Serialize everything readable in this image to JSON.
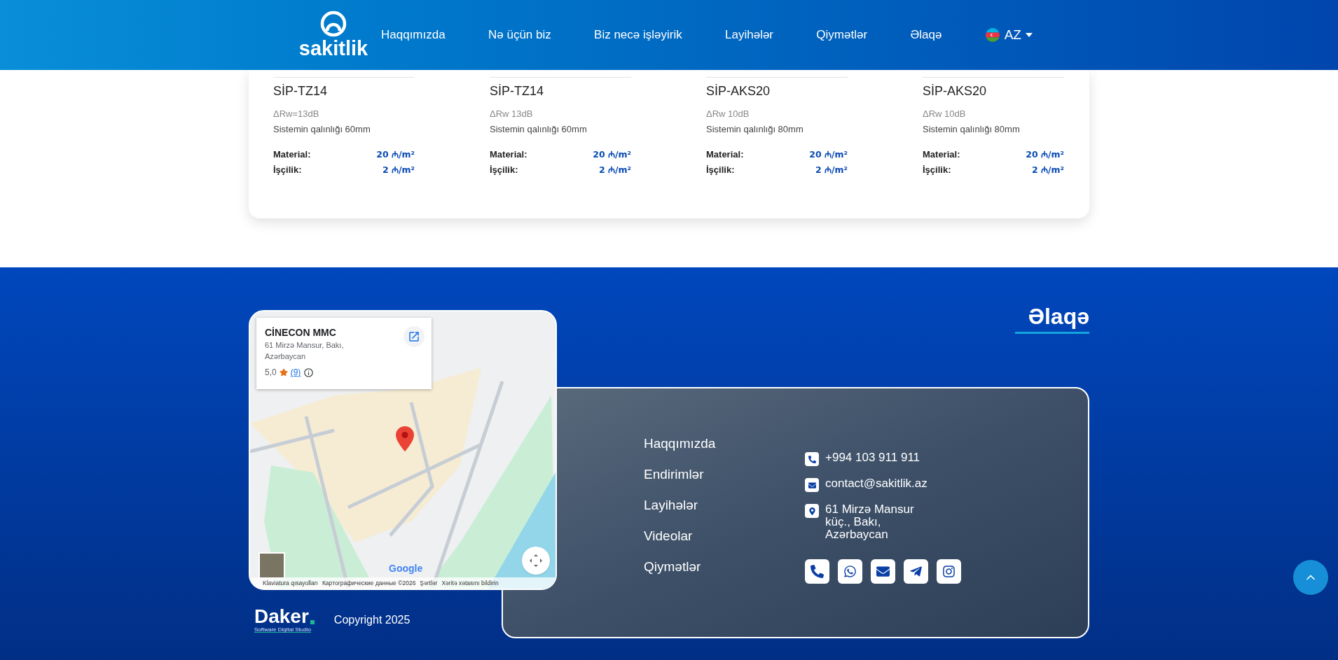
{
  "header": {
    "logo": "sakitlik",
    "nav": [
      "Haqqımızda",
      "Nə üçün biz",
      "Biz necə işləyirik",
      "Layihələr",
      "Qiymətlər",
      "Əlaqə"
    ],
    "language": {
      "code": "AZ"
    }
  },
  "products": [
    {
      "name": "SİP-TZ14",
      "specs": [
        "ΔRw=13dB",
        "Sistemin qalınlığı 60mm"
      ],
      "prices": [
        {
          "label": "Material:",
          "value": "20 ₼/m²"
        },
        {
          "label": "İşçilik:",
          "value": "2 ₼/m²"
        }
      ]
    },
    {
      "name": "SİP-TZ14",
      "specs": [
        "ΔRw 13dB",
        "Sistemin qalınlığı 60mm"
      ],
      "prices": [
        {
          "label": "Material:",
          "value": "20 ₼/m²"
        },
        {
          "label": "İşçilik:",
          "value": "2 ₼/m²"
        }
      ]
    },
    {
      "name": "SİP-AKS20",
      "specs": [
        "ΔRw 10dB",
        "Sistemin qalınlığı 80mm"
      ],
      "prices": [
        {
          "label": "Material:",
          "value": "20 ₼/m²"
        },
        {
          "label": "İşçilik:",
          "value": "2 ₼/m²"
        }
      ]
    },
    {
      "name": "SİP-AKS20",
      "specs": [
        "ΔRw 10dB",
        "Sistemin qalınlığı 80mm"
      ],
      "prices": [
        {
          "label": "Material:",
          "value": "20 ₼/m²"
        },
        {
          "label": "İşçilik:",
          "value": "2 ₼/m²"
        }
      ]
    }
  ],
  "map": {
    "place": "CİNECON MMC",
    "address": "61 Mirzə Mansur, Bakı, Azərbaycan",
    "rating": "5,0",
    "reviews": "(9)",
    "logo": "Google",
    "attribution": [
      "Klaviatura qısayolları",
      "Картографические данные ©2026",
      "Şərtlər",
      "Xəritə xətasını bildirin"
    ]
  },
  "contact": {
    "heading": "Əlaqə",
    "links": [
      "Haqqımızda",
      "Endirimlər",
      "Layihələr",
      "Videolar",
      "Qiymətlər"
    ],
    "details": [
      {
        "kind": "phone",
        "text": "+994 103 911 911"
      },
      {
        "kind": "email",
        "text": "contact@sakitlik.az"
      },
      {
        "kind": "address",
        "text": "61 Mirzə Mansur küç., Bakı, Azərbaycan"
      }
    ],
    "socials": [
      {
        "kind": "phone"
      },
      {
        "kind": "whatsapp"
      },
      {
        "kind": "email"
      },
      {
        "kind": "telegram"
      },
      {
        "kind": "instagram"
      }
    ]
  },
  "credit": {
    "logo": "Daker",
    "tagline": "Software Digital Studio",
    "copyright": "Copyright 2025"
  }
}
